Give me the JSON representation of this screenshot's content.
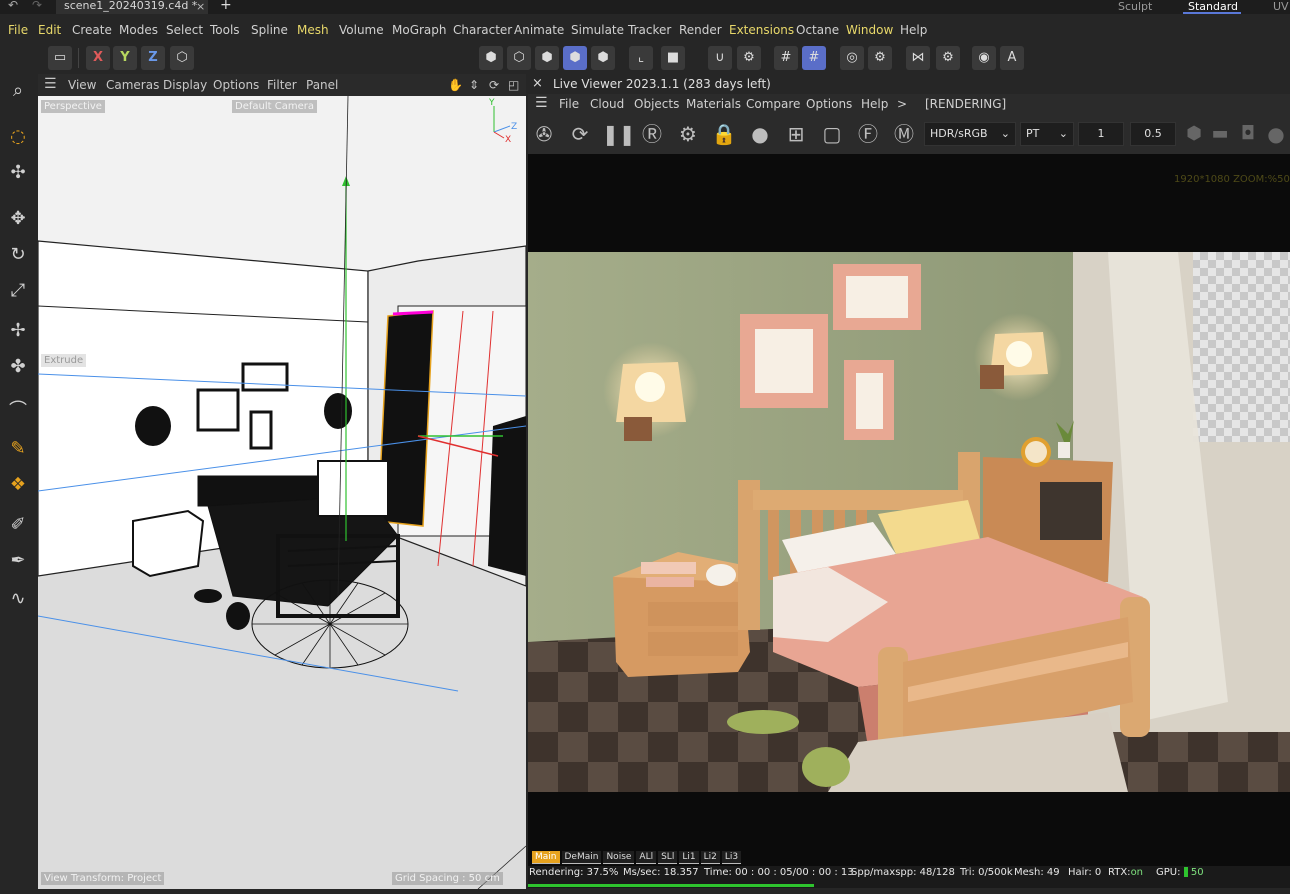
{
  "titlebar": {
    "file_tab": "scene1_20240319.c4d *",
    "close": "×",
    "new_tab": "+",
    "layouts": [
      "Sculpt",
      "Standard",
      "UV"
    ]
  },
  "menubar": [
    "File",
    "Edit",
    "Create",
    "Modes",
    "Select",
    "Tools",
    "Spline",
    "Mesh",
    "Volume",
    "MoGraph",
    "Character",
    "Animate",
    "Simulate",
    "Tracker",
    "Render",
    "Extensions",
    "Octane",
    "Window",
    "Help"
  ],
  "toolbar": {
    "x": "X",
    "y": "Y",
    "z": "Z"
  },
  "viewport": {
    "menu": [
      "View",
      "Cameras",
      "Display",
      "Options",
      "Filter",
      "Panel"
    ],
    "projection": "Perspective",
    "camera": "Default Camera",
    "object_label": "Extrude",
    "view_transform": "View Transform: Project",
    "grid_spacing": "Grid Spacing : 50 cm",
    "axis_y": "Y",
    "axis_z": "Z",
    "axis_x": "X"
  },
  "live_viewer": {
    "title": "Live Viewer 2023.1.1 (283 days left)",
    "close": "×",
    "menu": [
      "File",
      "Cloud",
      "Objects",
      "Materials",
      "Compare",
      "Options",
      "Help",
      ">",
      "[RENDERING]"
    ],
    "color_space": "HDR/sRGB",
    "kernel": "PT",
    "field1": "1",
    "field2": "0.5",
    "zoom_info": "1920*1080 ZOOM:%50",
    "passes": [
      "Main",
      "DeMain",
      "Noise",
      "ALl",
      "SLl",
      "Li1",
      "Li2",
      "Li3"
    ]
  },
  "status": {
    "rendering": "Rendering: 37.5%",
    "ms_sec_label": "Ms/sec: ",
    "ms_sec": "18.357",
    "time_label": "Time: ",
    "time": "00 : 00 : 05/00 : 00 : 13",
    "spp_label": "Spp/maxspp: ",
    "spp": "48/128",
    "tri_label": "Tri: ",
    "tri": "0/500k",
    "mesh_label": "Mesh: ",
    "mesh": "49",
    "hair_label": "Hair: ",
    "hair": "0",
    "rtx_label": "RTX:",
    "rtx": "on",
    "gpu_label": "GPU: ",
    "gpu": "50",
    "progress": 0.375
  },
  "colors": {
    "accent": "#5a6ec8",
    "menu_yellow": "#e8d86a",
    "pass_active": "#e6a21e",
    "progress_green": "#2ec42e"
  }
}
